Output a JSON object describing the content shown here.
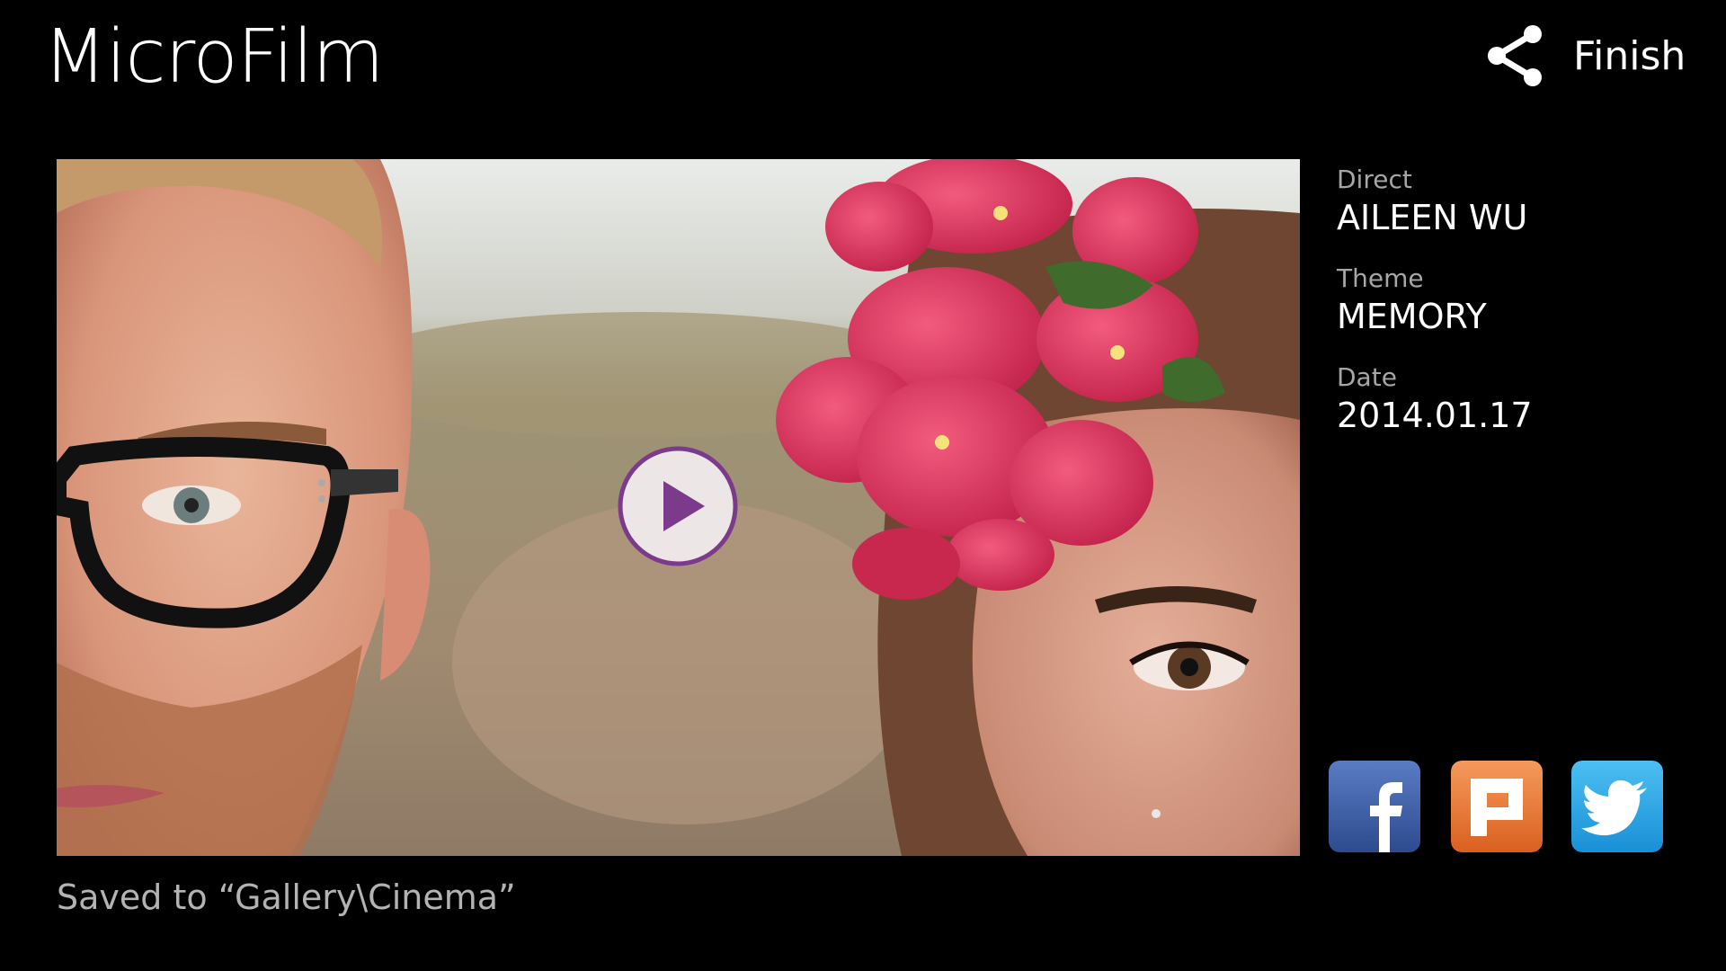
{
  "header": {
    "title": "MicroFilm",
    "finish_label": "Finish",
    "share_icon": "share-icon"
  },
  "preview": {
    "play_icon": "play-icon",
    "accent_color": "#7b3a8c"
  },
  "saved_note": "Saved to “Gallery\\Cinema”",
  "info": {
    "direct_label": "Direct",
    "direct_value": "AILEEN WU",
    "theme_label": "Theme",
    "theme_value": "MEMORY",
    "date_label": "Date",
    "date_value": "2014.01.17"
  },
  "social": [
    {
      "name": "facebook",
      "icon": "facebook-icon",
      "color": "#3b5998"
    },
    {
      "name": "plurk",
      "icon": "plurk-icon",
      "color": "#e8712f"
    },
    {
      "name": "twitter",
      "icon": "twitter-icon",
      "color": "#1fa0e8"
    }
  ]
}
